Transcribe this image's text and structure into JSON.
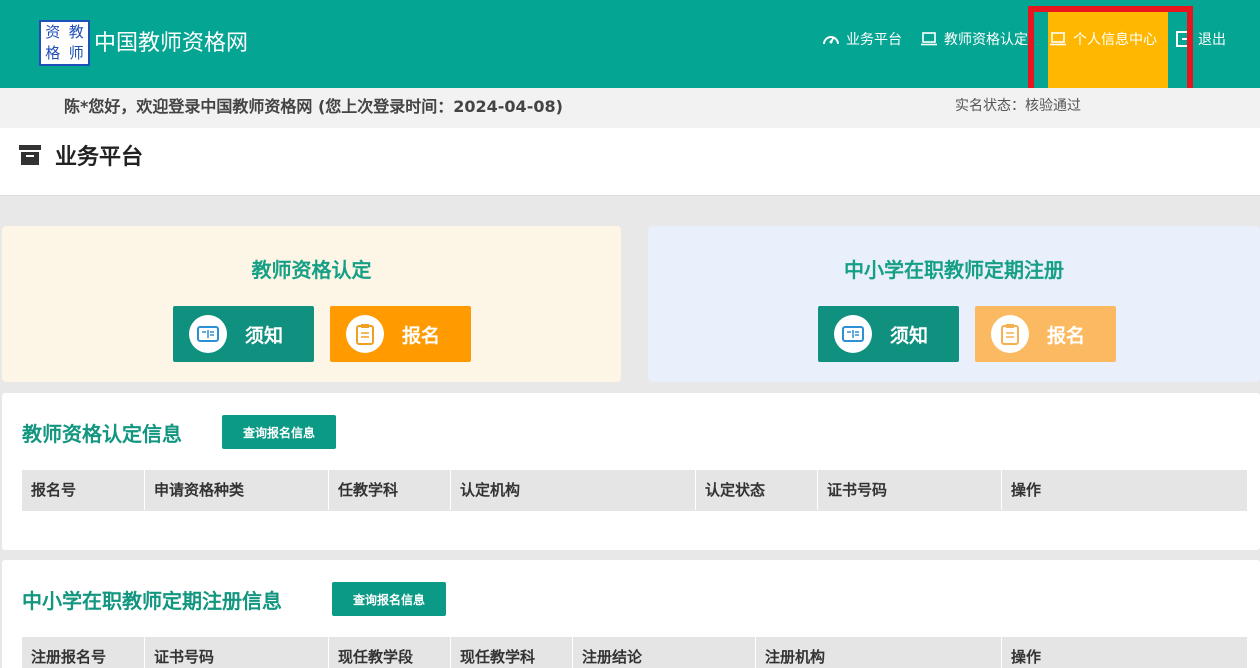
{
  "header": {
    "logo_chars": [
      "资",
      "教",
      "格",
      "师"
    ],
    "site_title": "中国教师资格网",
    "nav": [
      {
        "label": "业务平台",
        "icon": "dashboard-icon"
      },
      {
        "label": "教师资格认定",
        "icon": "laptop-icon"
      },
      {
        "label": "个人信息中心",
        "icon": "laptop-icon",
        "active": true
      },
      {
        "label": "退出",
        "icon": "logout-icon"
      }
    ]
  },
  "welcome": {
    "text": "陈*您好，欢迎登录中国教师资格网 (您上次登录时间：2024-04-08)",
    "realname_label": "实名状态：",
    "realname_value": "核验通过"
  },
  "page": {
    "title": "业务平台"
  },
  "cards": [
    {
      "title": "教师资格认定",
      "notice_label": "须知",
      "signup_label": "报名"
    },
    {
      "title": "中小学在职教师定期注册",
      "notice_label": "须知",
      "signup_label": "报名"
    }
  ],
  "panels": [
    {
      "title": "教师资格认定信息",
      "query_label": "查询报名信息",
      "columns": [
        "报名号",
        "申请资格种类",
        "任教学科",
        "认定机构",
        "认定状态",
        "证书号码",
        "操作"
      ]
    },
    {
      "title": "中小学在职教师定期注册信息",
      "query_label": "查询报名信息",
      "columns": [
        "注册报名号",
        "证书号码",
        "现任教学段",
        "现任教学科",
        "注册结论",
        "注册机构",
        "操作"
      ]
    }
  ],
  "colors": {
    "header": "#05a593",
    "active_nav": "#ffb700",
    "highlight_border": "#e8141e",
    "primary_teal": "#10917f",
    "orange": "#ff9a00"
  }
}
